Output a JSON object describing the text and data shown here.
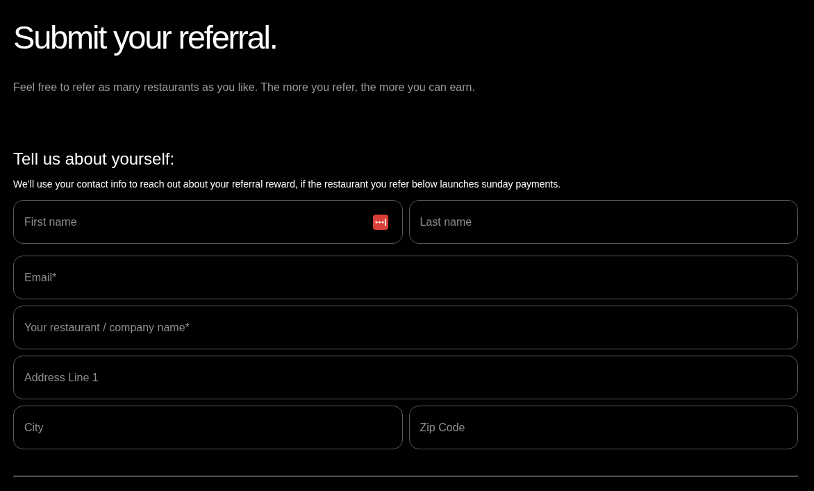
{
  "title": "Submit your referral.",
  "intro": "Feel free to refer as many restaurants as you like. The more you refer, the more you can earn.",
  "section": {
    "heading": "Tell us about yourself:",
    "note": "We’ll use your contact info to reach out about your referral reward, if the restaurant you refer below launches sunday payments."
  },
  "form_rows": [
    [
      {
        "placeholder": "First name",
        "autofill_icon": true
      },
      {
        "placeholder": "Last name",
        "autofill_icon": false
      }
    ],
    [
      {
        "placeholder": "Email*",
        "autofill_icon": false
      }
    ],
    [
      {
        "placeholder": "Your restaurant / company name*",
        "autofill_icon": false
      }
    ],
    [
      {
        "placeholder": "Address Line 1",
        "autofill_icon": false
      }
    ],
    [
      {
        "placeholder": "City",
        "autofill_icon": false
      },
      {
        "placeholder": "Zip Code",
        "autofill_icon": false
      }
    ]
  ]
}
